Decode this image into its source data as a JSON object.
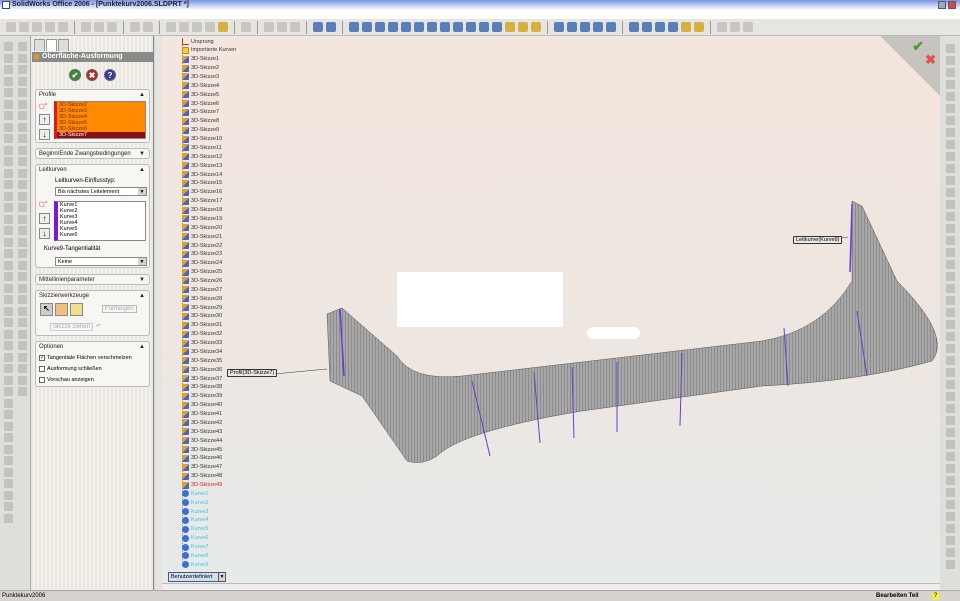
{
  "window": {
    "title": "SolidWorks Office 2006 - [Punktekurv2006.SLDPRT *]"
  },
  "property_manager": {
    "title": "Oberfläche-Ausformung",
    "ok": "✔",
    "cancel": "✖",
    "help": "?",
    "profile": {
      "label": "Profile",
      "items": [
        "3D-Skizze2",
        "3D-Skizze3",
        "3D-Skizze4",
        "3D-Skizze5",
        "3D-Skizze6",
        "3D-Skizze7"
      ]
    },
    "constraints": {
      "label": "Beginn/Ende Zwangsbedingungen"
    },
    "guides": {
      "label": "Leitkurven",
      "influence_label": "Leitkurven-Einflusstyp:",
      "influence_value": "Bis nächstes Leitelement",
      "items": [
        "Kurve1",
        "Kurve2",
        "Kurve3",
        "Kurve4",
        "Kurve5",
        "Kurve6"
      ],
      "tangency_label": "Kurve9-Tangentialität",
      "tangency_value": "Keine"
    },
    "centerline": {
      "label": "Mittellinienparameter"
    },
    "sketch_tools": {
      "label": "Skizzierwerkzeuge",
      "drag_label": "Formeigen",
      "drag_sketch": "Skizze ziehen"
    },
    "options": {
      "label": "Optionen",
      "items": [
        {
          "label": "Tangentiale Flächen verschmelzen",
          "checked": true
        },
        {
          "label": "Ausformung schließen",
          "checked": false
        },
        {
          "label": "Vorschau anzeigen",
          "checked": false
        }
      ]
    }
  },
  "tree": {
    "origin": "Ursprung",
    "folder": "Importierte Kurven",
    "sketches": [
      "3D-Skizze1",
      "3D-Skizze2",
      "3D-Skizze3",
      "3D-Skizze4",
      "3D-Skizze5",
      "3D-Skizze6",
      "3D-Skizze7",
      "3D-Skizze8",
      "3D-Skizze9",
      "3D-Skizze10",
      "3D-Skizze11",
      "3D-Skizze12",
      "3D-Skizze13",
      "3D-Skizze14",
      "3D-Skizze15",
      "3D-Skizze16",
      "3D-Skizze17",
      "3D-Skizze18",
      "3D-Skizze19",
      "3D-Skizze20",
      "3D-Skizze21",
      "3D-Skizze22",
      "3D-Skizze23",
      "3D-Skizze24",
      "3D-Skizze25",
      "3D-Skizze26",
      "3D-Skizze27",
      "3D-Skizze28",
      "3D-Skizze29",
      "3D-Skizze30",
      "3D-Skizze31",
      "3D-Skizze32",
      "3D-Skizze33",
      "3D-Skizze34",
      "3D-Skizze35",
      "3D-Skizze36",
      "3D-Skizze37",
      "3D-Skizze38",
      "3D-Skizze39",
      "3D-Skizze40",
      "3D-Skizze41",
      "3D-Skizze42",
      "3D-Skizze43",
      "3D-Skizze44",
      "3D-Skizze45",
      "3D-Skizze46",
      "3D-Skizze47",
      "3D-Skizze48",
      "3D-Skizze49"
    ],
    "curves": [
      "Kurve1",
      "Kurve2",
      "Kurve3",
      "Kurve4",
      "Kurve5",
      "Kurve6",
      "Kurve7",
      "Kurve8",
      "Kurve9"
    ],
    "colors": {
      "normal": "#333333",
      "selected_sketch": "#e02020",
      "curve": "#30c8e8"
    }
  },
  "viewport": {
    "profile_callout": "Profil(3D-Skizze7)",
    "guide_callout": "Leitkurve(Kurve9)",
    "coord_system": "Benutzerdefiniert"
  },
  "status": {
    "left": "Punktekurv2006",
    "right": "Bearbeiten Teil",
    "help": "?"
  }
}
